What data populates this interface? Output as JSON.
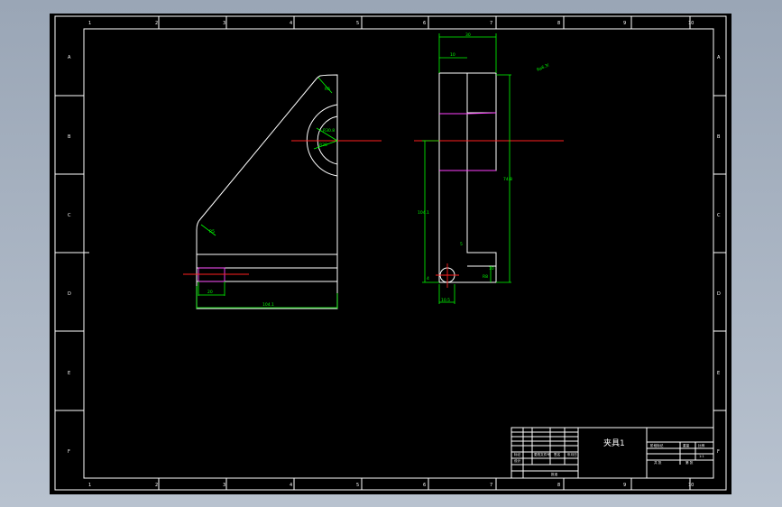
{
  "zone_columns": [
    "1",
    "2",
    "3",
    "4",
    "5",
    "6",
    "7",
    "8",
    "9",
    "10"
  ],
  "zone_rows": [
    "A",
    "B",
    "C",
    "D",
    "E",
    "F"
  ],
  "front_view": {
    "dims": {
      "d_top": "R6",
      "d_radius": "R30.8",
      "d_inner": "R20",
      "d_fillet": "R5",
      "d_width": "80",
      "d_hole": "20",
      "d_bottom": "104.1"
    }
  },
  "side_view": {
    "dims": {
      "d_total": "30",
      "d_step": "10",
      "d_height": "74.8",
      "d_left": "104.1",
      "d_small": "5",
      "d_base": "10",
      "d_right": "R8",
      "d_foot": "10.5",
      "d_tiny": "4"
    }
  },
  "surface_note": "Ra6.3/",
  "title_block": {
    "part_name": "夹具1",
    "sheet_label": "共 张",
    "scale": "1:1",
    "labels": [
      "标记",
      "处数",
      "分区",
      "更改文件号",
      "签名",
      "年月日",
      "设计",
      "标准化",
      "审核",
      "工艺",
      "批准",
      "阶段标记",
      "重量",
      "比例",
      "第 张"
    ]
  }
}
